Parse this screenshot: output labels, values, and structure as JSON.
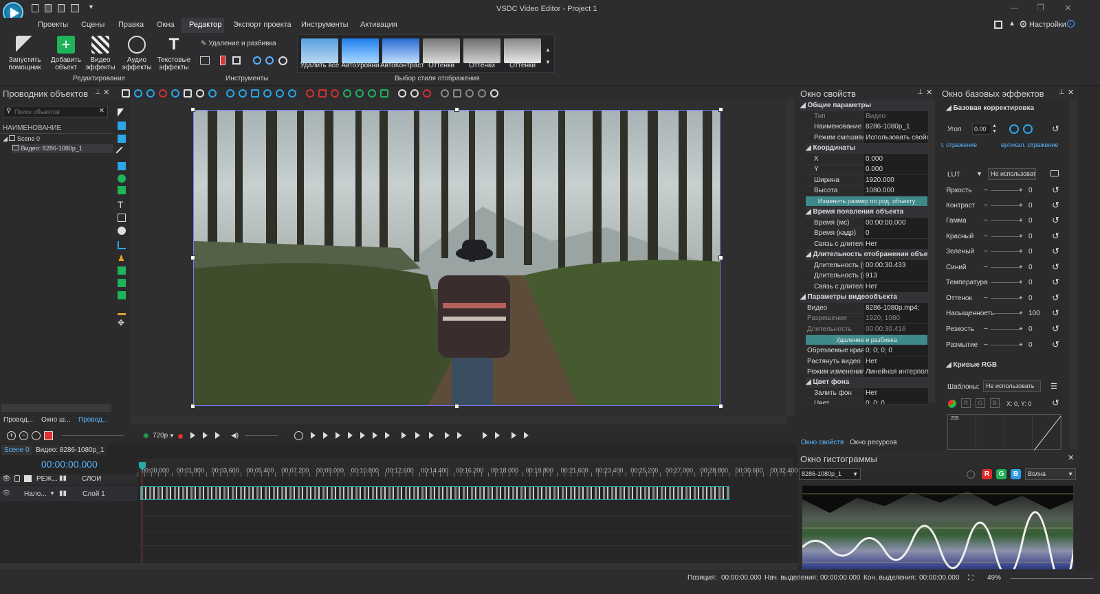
{
  "app": {
    "title": "VSDC Video Editor - Project 1"
  },
  "menu": {
    "items": [
      "Проекты",
      "Сцены",
      "Правка",
      "Окна",
      "Редактор",
      "Экспорт проекта",
      "Инструменты",
      "Активация"
    ],
    "settings": "Настройки"
  },
  "ribbon": {
    "buttons": [
      "Запустить помощник",
      "Добавить объект",
      "Видео эффекты",
      "Аудио эффекты",
      "Текстовые эффекты"
    ],
    "cut_split": "Удаление и разбивка",
    "groups": {
      "edit": "Редактирование",
      "tools": "Инструменты",
      "styles": "Выбор стиля отображения"
    },
    "styles": [
      "Удалить все",
      "АвтоУровни",
      "АвтоКонтраст",
      "Оттенки",
      "Оттенки",
      "Оттенки"
    ]
  },
  "explorer": {
    "title": "Проводник объектов",
    "search_placeholder": "Поиск объектов",
    "column": "НАИМЕНОВАНИЕ",
    "tree": [
      "Scene 0",
      "Видео: 8286-1080p_1"
    ],
    "tabs": [
      "Провод...",
      "Окно ш...",
      "Провод..."
    ]
  },
  "properties": {
    "title": "Окно свойств",
    "sections": {
      "general": "Общие параметры",
      "coords": "Координаты",
      "appear": "Время появления объекта",
      "duration": "Длительность отображения объекта",
      "video": "Параметры видеообъекта",
      "bg": "Цвет фона"
    },
    "rows": [
      {
        "k": "Тип",
        "v": "Видео"
      },
      {
        "k": "Наименование",
        "v": "8286-1080p_1"
      },
      {
        "k": "Режим смешивания",
        "v": "Использовать свойство"
      },
      {
        "k": "X",
        "v": "0.000"
      },
      {
        "k": "Y",
        "v": "0.000"
      },
      {
        "k": "Ширина",
        "v": "1920.000"
      },
      {
        "k": "Высота",
        "v": "1080.000"
      },
      {
        "k": "Время (мс)",
        "v": "00:00:00.000"
      },
      {
        "k": "Время (кадр)",
        "v": "0"
      },
      {
        "k": "Связь с длительностью",
        "v": "Нет"
      },
      {
        "k": "Длительность (мс)",
        "v": "00:00:30.433"
      },
      {
        "k": "Длительность (кадр)",
        "v": "913"
      },
      {
        "k": "Связь с длительностью",
        "v": "Нет"
      },
      {
        "k": "Видео",
        "v": "8286-1080p.mp4;"
      },
      {
        "k": "Разрешение",
        "v": "1920; 1080"
      },
      {
        "k": "Длительность",
        "v": "00:00:30.416"
      },
      {
        "k": "Обрезаемые края",
        "v": "0; 0; 0; 0"
      },
      {
        "k": "Растянуть видео",
        "v": "Нет"
      },
      {
        "k": "Режим изменения",
        "v": "Линейная интерполяция"
      },
      {
        "k": "Залить фон",
        "v": "Нет"
      },
      {
        "k": "Цвет",
        "v": "0; 0; 0"
      }
    ],
    "resize_btn": "Изменить размер по род. объекту",
    "cut_btn": "Удаление и разбивка",
    "tabs": [
      "Окно свойств",
      "Окно ресурсов"
    ]
  },
  "effects": {
    "title": "Окно базовых эффектов",
    "section": "Базовая корректировка",
    "angle_label": "Угол",
    "angle": "0.00",
    "flip_h": "т. отражение",
    "flip_v": "ертикал. отражение",
    "lut_label": "LUT",
    "lut_value": "Не использовать",
    "rows": [
      {
        "k": "Яркость",
        "v": "0"
      },
      {
        "k": "Контраст",
        "v": "0"
      },
      {
        "k": "Гамма",
        "v": "0"
      },
      {
        "k": "Красный",
        "v": "0"
      },
      {
        "k": "Зеленый",
        "v": "0"
      },
      {
        "k": "Синий",
        "v": "0"
      },
      {
        "k": "Температура",
        "v": "0"
      },
      {
        "k": "Оттенок",
        "v": "0"
      },
      {
        "k": "Насыщенность",
        "v": "100"
      },
      {
        "k": "Резкость",
        "v": "0"
      },
      {
        "k": "Размытие",
        "v": "0"
      }
    ],
    "curves": "Кривые RGB",
    "templates_label": "Шаблоны:",
    "templates_value": "Не использовать",
    "xy": "X: 0, Y: 0",
    "graph_max": "255",
    "rgb": [
      "R",
      "G",
      "B"
    ]
  },
  "histogram": {
    "title": "Окно гистограммы",
    "source": "8286-1080p_1",
    "mode": "Волна",
    "rgb": [
      "R",
      "G",
      "B"
    ]
  },
  "player": {
    "quality": "720p"
  },
  "timeline": {
    "tabs": [
      "Scene 0",
      "Видео: 8286-1080p_1"
    ],
    "timecode": "00:00:00.000",
    "ticks": [
      "00:00.000",
      "00:01.800",
      "00:03.600",
      "00:05.400",
      "00:07.200",
      "00:09.000",
      "00:10.800",
      "00:12.600",
      "00:14.400",
      "00:16.200",
      "00:18.000",
      "00:19.800",
      "00:21.600",
      "00:23.400",
      "00:25.200",
      "00:27.000",
      "00:28.800",
      "00:30.600",
      "00:32.400"
    ],
    "track_header": {
      "mode": "РЕЖ...",
      "layers": "СЛОИ"
    },
    "track1": {
      "mode": "Нало...",
      "name": "Слой 1"
    }
  },
  "status": {
    "position_label": "Позиция:",
    "position": "00:00:00.000",
    "sel_start_label": "Нач. выделения:",
    "sel_start": "00:00:00.000",
    "sel_end_label": "Кон. выделения:",
    "sel_end": "00:00:00.000",
    "zoom": "49%"
  }
}
